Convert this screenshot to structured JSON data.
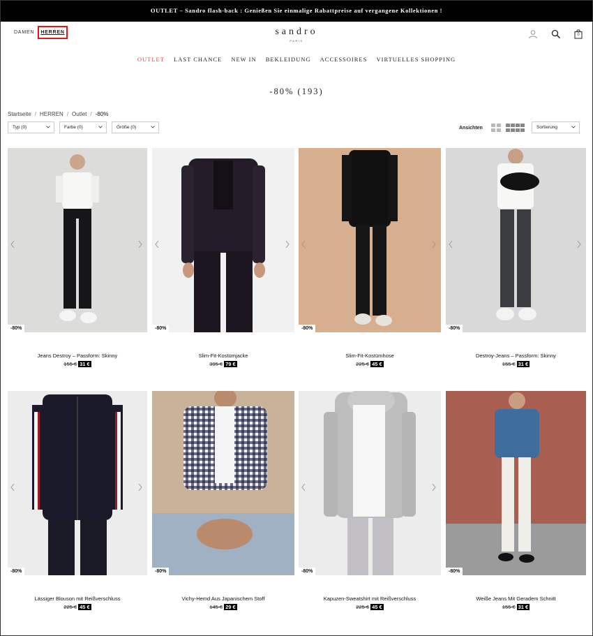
{
  "promo": "OUTLET – Sandro flash-back : Genießen Sie einmalige Rabattpreise auf vergangene Kollektionen !",
  "header": {
    "gender": [
      "DAMEN",
      "HERREN"
    ],
    "logo": "sandro",
    "logo_sub": "PARIS",
    "bag_count": "0",
    "icons": [
      "user-icon",
      "search-icon",
      "bag-icon"
    ]
  },
  "nav": [
    "OUTLET",
    "LAST CHANCE",
    "NEW IN",
    "BEKLEIDUNG",
    "ACCESSOIRES",
    "VIRTUELLES SHOPPING"
  ],
  "title": "-80% (193)",
  "breadcrumb": [
    "Startseite",
    "HERREN",
    "Outlet",
    "-80%"
  ],
  "filters": {
    "typ": "Typ (0)",
    "farbe": "Farbe (0)",
    "groesse": "Größe (0)",
    "sort": "Sortierung"
  },
  "views_label": "Ansichten",
  "colors": {
    "accent": "#e2443a",
    "highlight": "#d81b1b"
  },
  "products": [
    {
      "name": "Jeans Destroy – Passform: Skinny",
      "old": "155 €",
      "new": "31 €",
      "discount": "-80%"
    },
    {
      "name": "Slim-Fit-Kostümjacke",
      "old": "395 €",
      "new": "79 €",
      "discount": "-80%"
    },
    {
      "name": "Slim-Fit-Kostümhose",
      "old": "225 €",
      "new": "45 €",
      "discount": "-80%"
    },
    {
      "name": "Destroy-Jeans – Passform: Skinny",
      "old": "155 €",
      "new": "31 €",
      "discount": "-80%"
    },
    {
      "name": "Lässiger Blouson mit Reißverschluss",
      "old": "225 €",
      "new": "45 €",
      "discount": "-80%"
    },
    {
      "name": "Vichy-Hemd Aus Japanischem Stoff",
      "old": "145 €",
      "new": "29 €",
      "discount": "-80%"
    },
    {
      "name": "Kapuzen-Sweatshirt mit Reißverschluss",
      "old": "225 €",
      "new": "45 €",
      "discount": "-80%"
    },
    {
      "name": "Weiße Jeans Mit Geradem Schnitt",
      "old": "155 €",
      "new": "31 €",
      "discount": "-80%"
    }
  ]
}
